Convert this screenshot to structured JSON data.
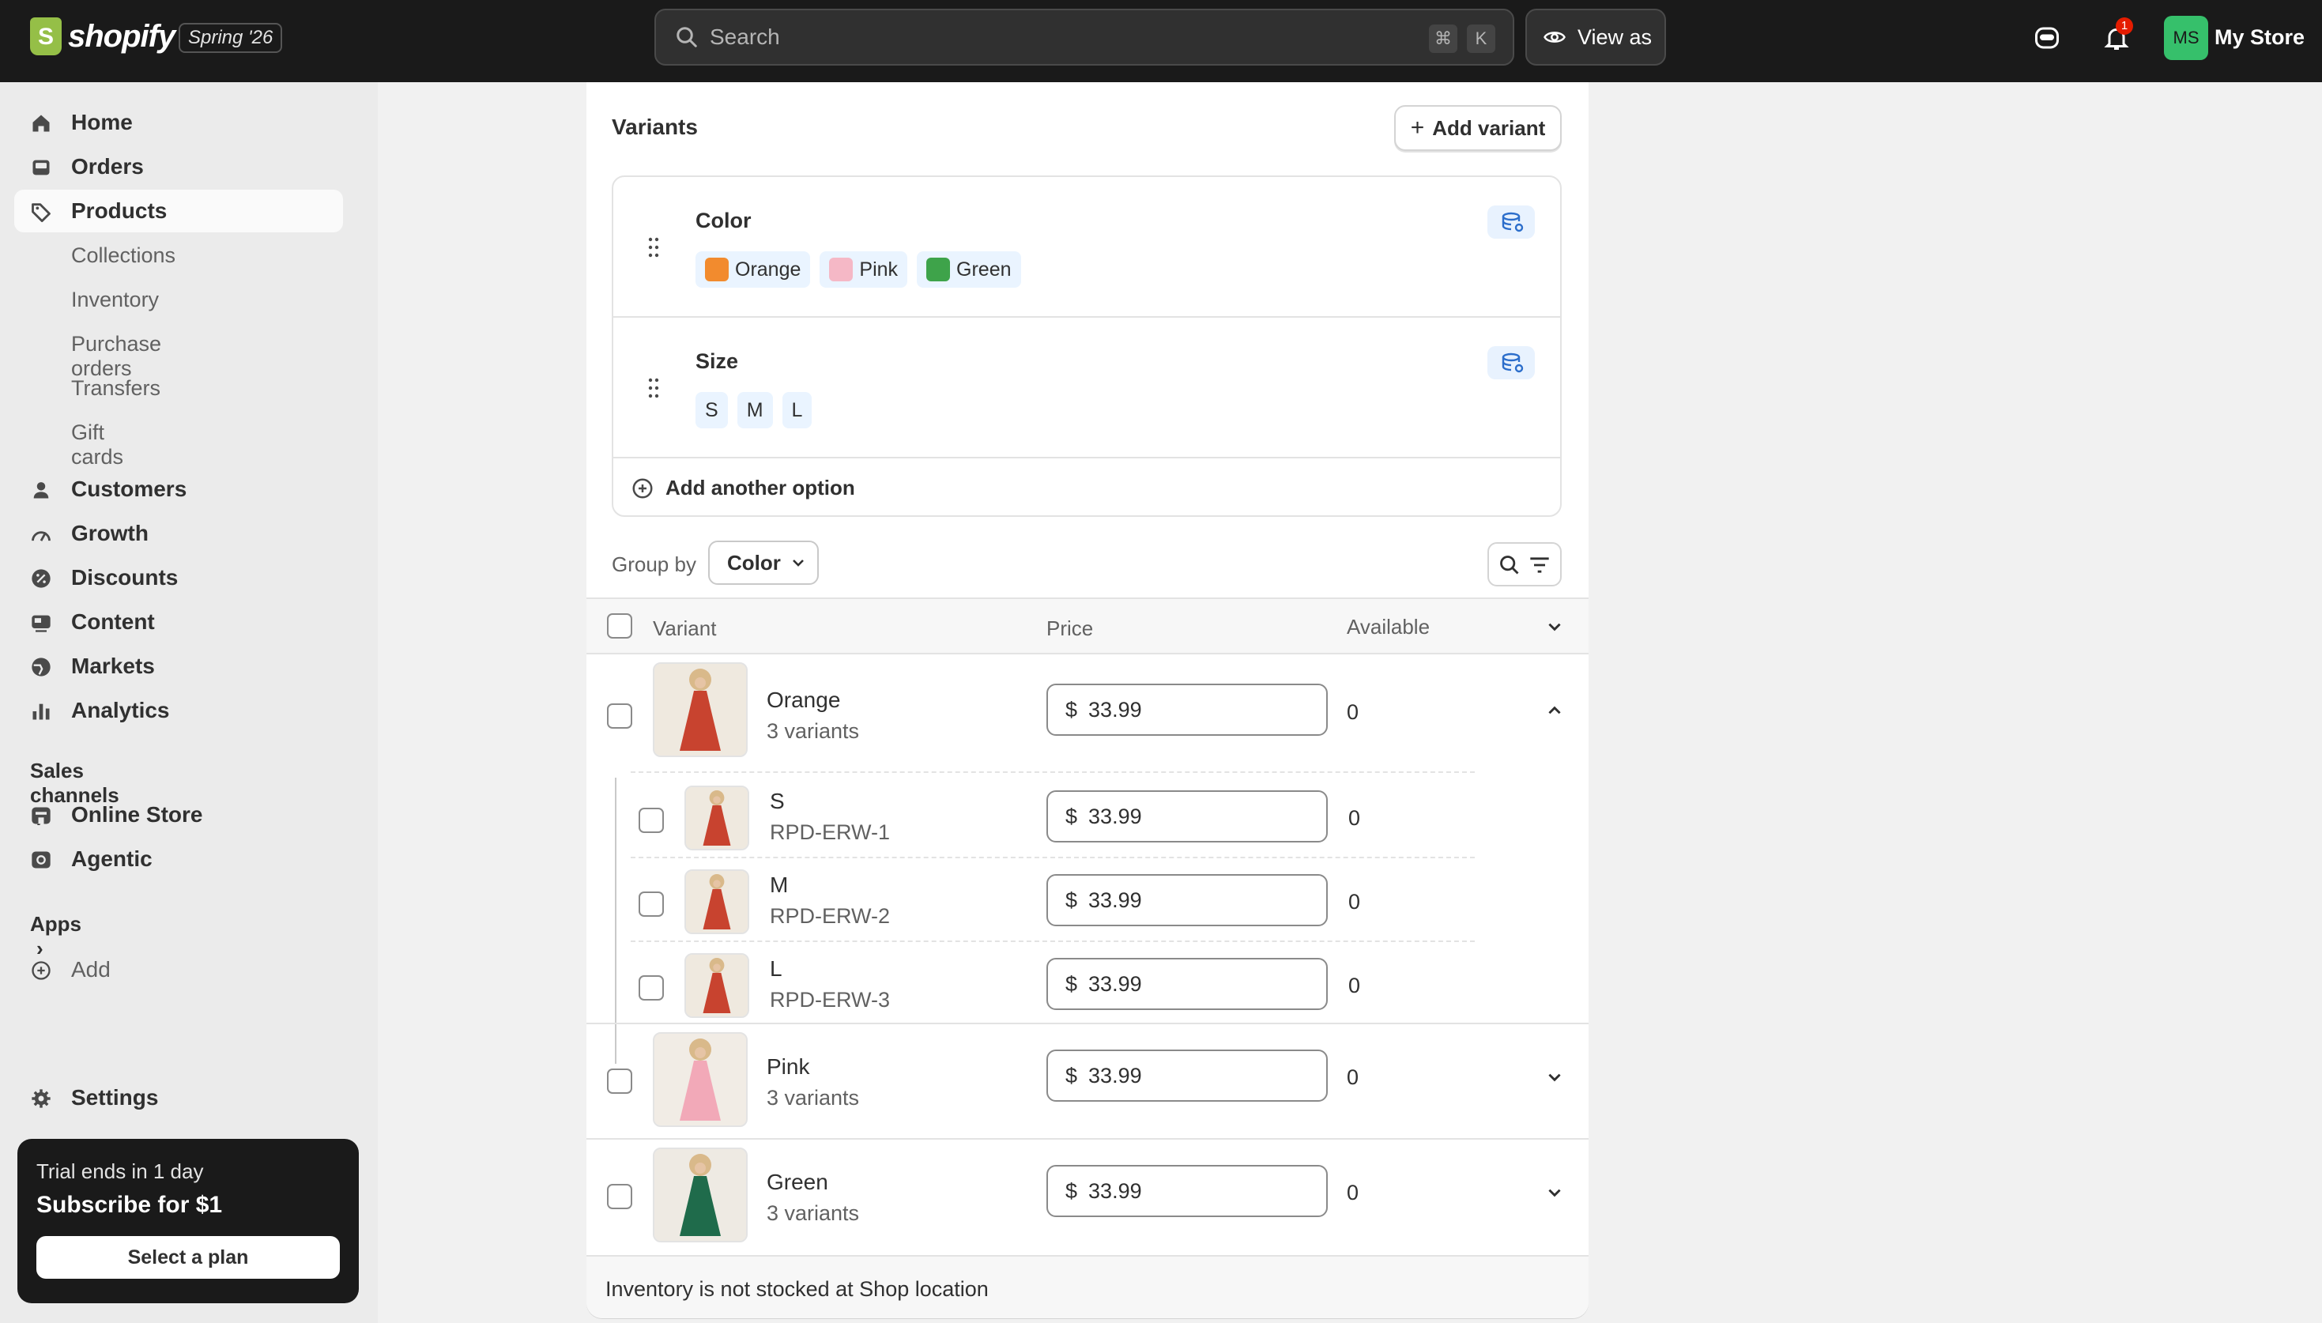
{
  "topbar": {
    "brand": "shopify",
    "edition": "Spring '26",
    "search_placeholder": "Search",
    "shortcut_cmd": "⌘",
    "shortcut_key": "K",
    "view_as": "View as",
    "notification_count": "1",
    "avatar_initials": "MS",
    "store_name": "My Store"
  },
  "sidebar": {
    "items": [
      {
        "label": "Home",
        "icon": "home-icon"
      },
      {
        "label": "Orders",
        "icon": "inbox-icon"
      },
      {
        "label": "Products",
        "icon": "tag-icon"
      }
    ],
    "product_sub": [
      "Collections",
      "Inventory",
      "Purchase orders",
      "Transfers",
      "Gift cards"
    ],
    "items2": [
      {
        "label": "Customers",
        "icon": "person-icon"
      },
      {
        "label": "Growth",
        "icon": "gauge-icon"
      },
      {
        "label": "Discounts",
        "icon": "discount-icon"
      },
      {
        "label": "Content",
        "icon": "content-icon"
      },
      {
        "label": "Markets",
        "icon": "globe-icon"
      },
      {
        "label": "Analytics",
        "icon": "bar-chart-icon"
      }
    ],
    "sales_channels_label": "Sales channels",
    "channels": [
      {
        "label": "Online Store",
        "icon": "store-icon"
      },
      {
        "label": "Agentic",
        "icon": "agent-icon"
      }
    ],
    "apps_label": "Apps",
    "add_label": "Add",
    "settings_label": "Settings",
    "trial": {
      "line1": "Trial ends in 1 day",
      "line2": "Subscribe for $1",
      "button": "Select a plan"
    }
  },
  "variants_card": {
    "title": "Variants",
    "add_variant": "Add variant",
    "options": [
      {
        "name": "Color",
        "values": [
          {
            "label": "Orange",
            "color": "#f28b2e"
          },
          {
            "label": "Pink",
            "color": "#f5b8c6"
          },
          {
            "label": "Green",
            "color": "#3ea34a"
          }
        ]
      },
      {
        "name": "Size",
        "values": [
          {
            "label": "S"
          },
          {
            "label": "M"
          },
          {
            "label": "L"
          }
        ]
      }
    ],
    "add_another_option": "Add another option",
    "group_by_label": "Group by",
    "group_by_value": "Color",
    "columns": [
      "Variant",
      "Price",
      "Available"
    ],
    "groups": [
      {
        "name": "Orange",
        "count": "3 variants",
        "currency": "$",
        "price": "33.99",
        "available": "0",
        "dress_color": "#c8432f",
        "expanded": true,
        "children": [
          {
            "name": "S",
            "sku": "RPD-ERW-1",
            "currency": "$",
            "price": "33.99",
            "available": "0"
          },
          {
            "name": "M",
            "sku": "RPD-ERW-2",
            "currency": "$",
            "price": "33.99",
            "available": "0"
          },
          {
            "name": "L",
            "sku": "RPD-ERW-3",
            "currency": "$",
            "price": "33.99",
            "available": "0"
          }
        ]
      },
      {
        "name": "Pink",
        "count": "3 variants",
        "currency": "$",
        "price": "33.99",
        "available": "0",
        "dress_color": "#f2a9b8",
        "expanded": false
      },
      {
        "name": "Green",
        "count": "3 variants",
        "currency": "$",
        "price": "33.99",
        "available": "0",
        "dress_color": "#1f6b4b",
        "expanded": false
      }
    ],
    "footer_note": "Inventory is not stocked at Shop location"
  }
}
